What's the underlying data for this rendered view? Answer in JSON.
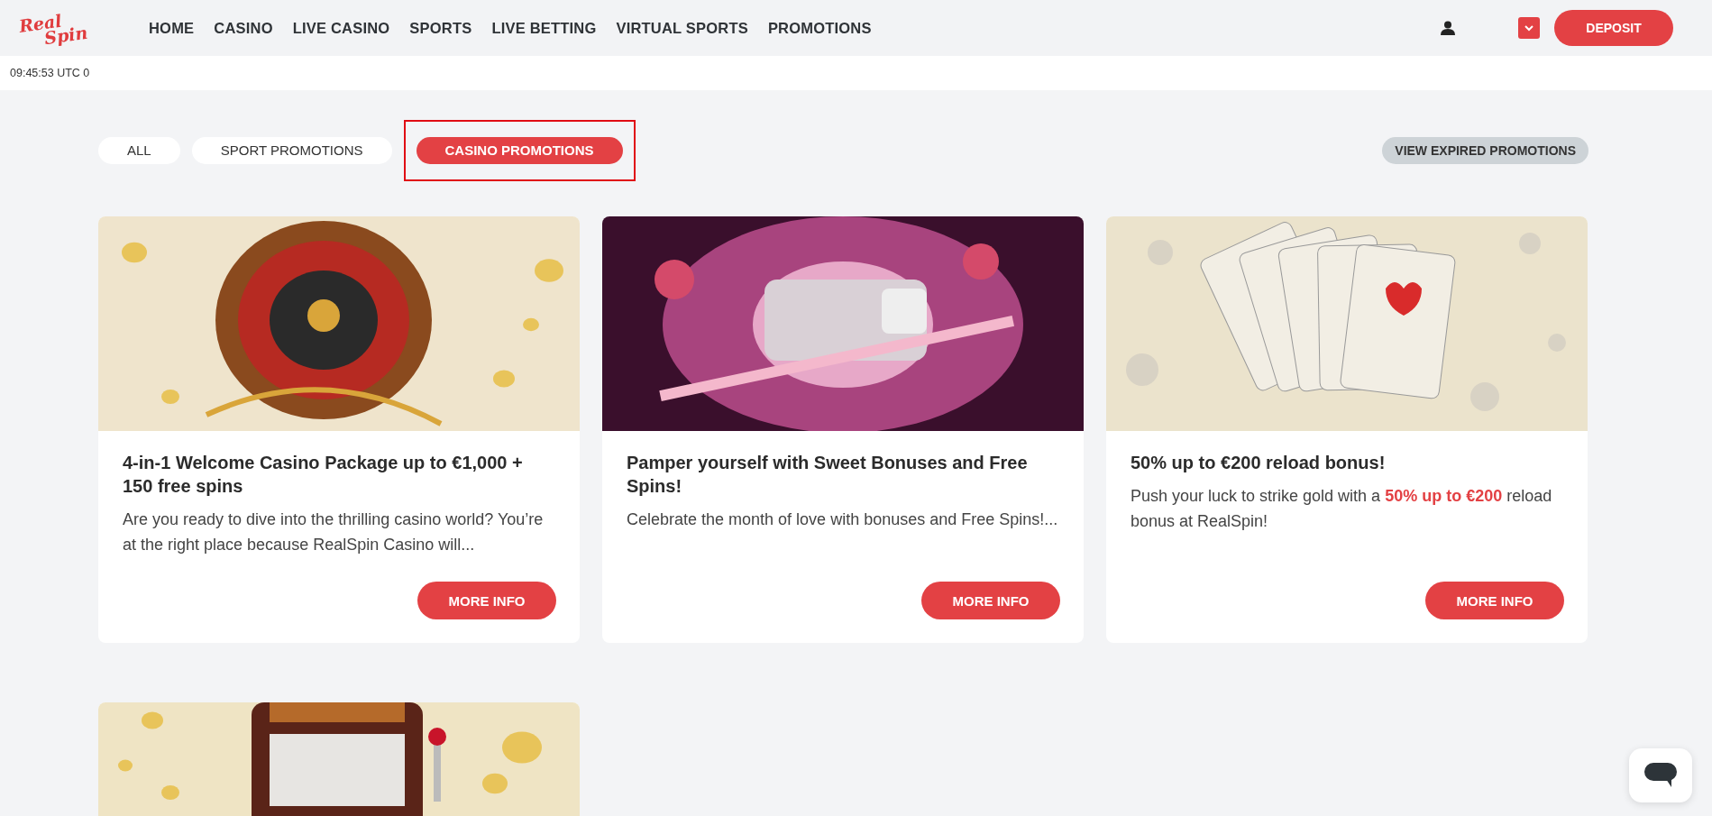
{
  "header": {
    "logo": [
      "Real",
      "Spin"
    ],
    "nav": [
      "HOME",
      "CASINO",
      "LIVE CASINO",
      "SPORTS",
      "LIVE BETTING",
      "VIRTUAL SPORTS",
      "PROMOTIONS"
    ],
    "deposit": "DEPOSIT"
  },
  "time_bar": {
    "time": "09:45:53 UTC 0"
  },
  "filters": [
    {
      "label": "ALL",
      "selected": false,
      "outlined": false
    },
    {
      "label": "SPORT PROMOTIONS",
      "selected": false,
      "outlined": false
    },
    {
      "label": "CASINO PROMOTIONS",
      "selected": true,
      "outlined": true
    }
  ],
  "expired_button": "VIEW EXPIRED PROMOTIONS",
  "cards": [
    {
      "kind": "full",
      "title": "4-in-1 Welcome Casino Package up to €1,000 + 150 free spins",
      "description": "Are you ready to dive into the thrilling casino world? You’re at the right place because RealSpin Casino will...",
      "button": "MORE INFO"
    },
    {
      "kind": "full",
      "title": "Pamper yourself with Sweet Bonuses and Free Spins!",
      "description": "Celebrate the month of love with bonuses and Free Spins!...",
      "button": "MORE INFO"
    },
    {
      "kind": "full",
      "title": "50% up to €200 reload bonus!",
      "description": "Push your luck to strike gold with a **50% up to €200** reload bonus at RealSpin!",
      "button": "MORE INFO"
    },
    {
      "kind": "image_only"
    }
  ]
}
